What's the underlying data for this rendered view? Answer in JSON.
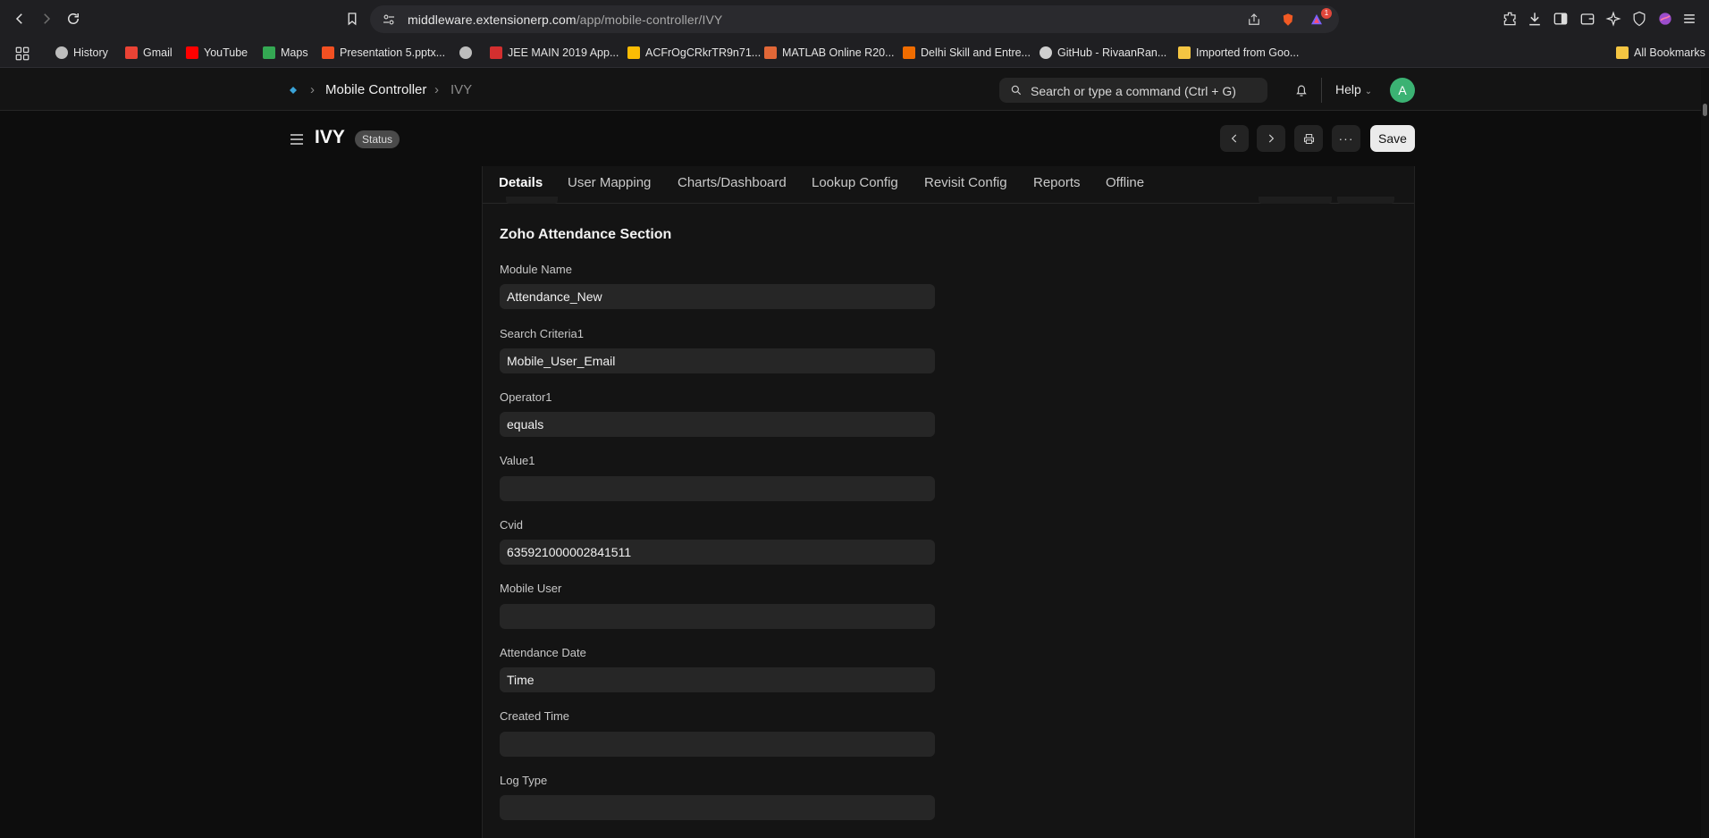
{
  "browser": {
    "url_host": "middleware.extensionerp.com",
    "url_path": "/app/mobile-controller/IVY",
    "shields_badge": "1",
    "bookmarks": [
      {
        "label": "History",
        "icon": "clock-icon",
        "color": "#bdbdbd"
      },
      {
        "label": "Gmail",
        "icon": "gmail-icon",
        "color": "#ea4335"
      },
      {
        "label": "YouTube",
        "icon": "youtube-icon",
        "color": "#ff0000"
      },
      {
        "label": "Maps",
        "icon": "maps-icon",
        "color": "#34a853"
      },
      {
        "label": "Presentation 5.pptx...",
        "icon": "office-icon",
        "color": "#f25022"
      },
      {
        "label": "",
        "icon": "globe-icon",
        "color": "#bdbdbd"
      },
      {
        "label": "JEE MAIN 2019 App...",
        "icon": "jee-icon",
        "color": "#d32f2f"
      },
      {
        "label": "ACFrOgCRkrTR9n71...",
        "icon": "drive-icon",
        "color": "#fbbc04"
      },
      {
        "label": "MATLAB Online R20...",
        "icon": "matlab-icon",
        "color": "#e16737"
      },
      {
        "label": "Delhi Skill and Entre...",
        "icon": "dseu-icon",
        "color": "#ef6c00"
      },
      {
        "label": "GitHub - RivaanRan...",
        "icon": "github-icon",
        "color": "#cfcfcf"
      },
      {
        "label": "Imported from Goo...",
        "icon": "folder-icon",
        "color": "#f4c542"
      }
    ],
    "all_bookmarks": "All Bookmarks"
  },
  "app": {
    "breadcrumbs": [
      "Mobile Controller",
      "IVY"
    ],
    "search_placeholder": "Search or type a command (Ctrl + G)",
    "help": "Help",
    "avatar_initial": "A"
  },
  "page": {
    "title": "IVY",
    "status": "Status",
    "save_label": "Save"
  },
  "tabs": [
    "Details",
    "User Mapping",
    "Charts/Dashboard",
    "Lookup Config",
    "Revisit Config",
    "Reports",
    "Offline"
  ],
  "section": {
    "title": "Zoho Attendance Section",
    "fields": [
      {
        "label": "Module Name",
        "value": "Attendance_New"
      },
      {
        "label": "Search Criteria1",
        "value": "Mobile_User_Email"
      },
      {
        "label": "Operator1",
        "value": "equals"
      },
      {
        "label": "Value1",
        "value": ""
      },
      {
        "label": "Cvid",
        "value": "635921000002841511"
      },
      {
        "label": "Mobile User",
        "value": ""
      },
      {
        "label": "Attendance Date",
        "value": "Time"
      },
      {
        "label": "Created Time",
        "value": ""
      },
      {
        "label": "Log Type",
        "value": ""
      }
    ]
  }
}
